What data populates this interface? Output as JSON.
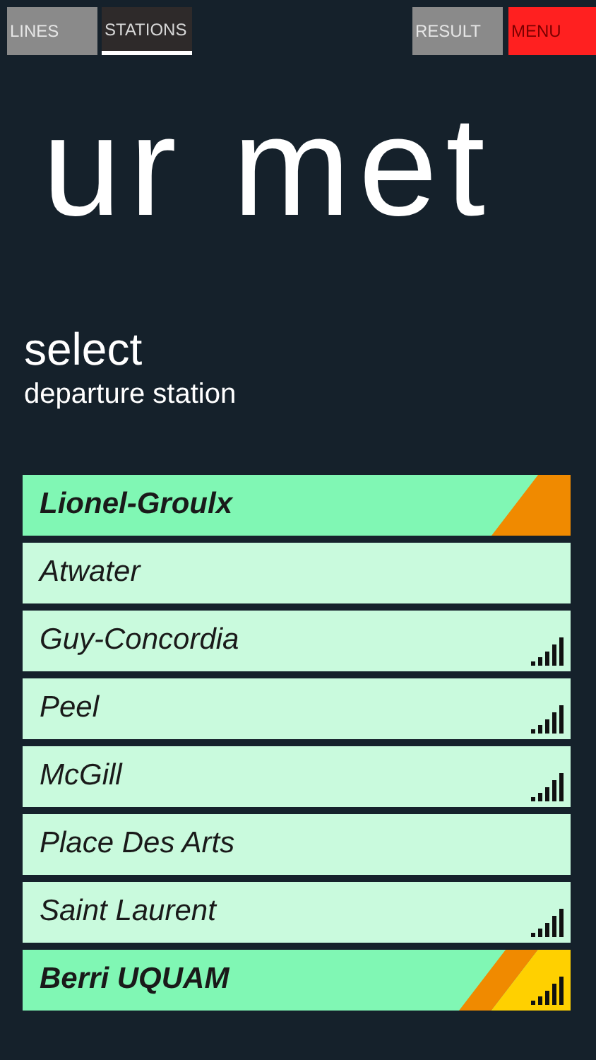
{
  "tabs": [
    {
      "label": "LINES",
      "kind": "tab",
      "selected": false
    },
    {
      "label": "STATIONS",
      "kind": "tab",
      "selected": true
    },
    {
      "label": "RESULT",
      "kind": "tab",
      "selected": false
    },
    {
      "label": "MENU",
      "kind": "menu",
      "selected": false
    }
  ],
  "hero_title": "ur met",
  "heading": "select",
  "subheading": "departure station",
  "stations": [
    {
      "name": "Lionel-Groulx",
      "selected": true,
      "stripes": [
        {
          "color": "#f08a00"
        }
      ],
      "signal": false
    },
    {
      "name": "Atwater",
      "selected": false,
      "signal": false
    },
    {
      "name": "Guy-Concordia",
      "selected": false,
      "signal": true
    },
    {
      "name": "Peel",
      "selected": false,
      "signal": true
    },
    {
      "name": "McGill",
      "selected": false,
      "signal": true
    },
    {
      "name": "Place Des Arts",
      "selected": false,
      "signal": false
    },
    {
      "name": "Saint Laurent",
      "selected": false,
      "signal": true
    },
    {
      "name": "Berri UQUAM",
      "selected": true,
      "stripes": [
        {
          "color": "#f08a00"
        },
        {
          "color": "#ffd000"
        }
      ],
      "signal": true
    }
  ]
}
